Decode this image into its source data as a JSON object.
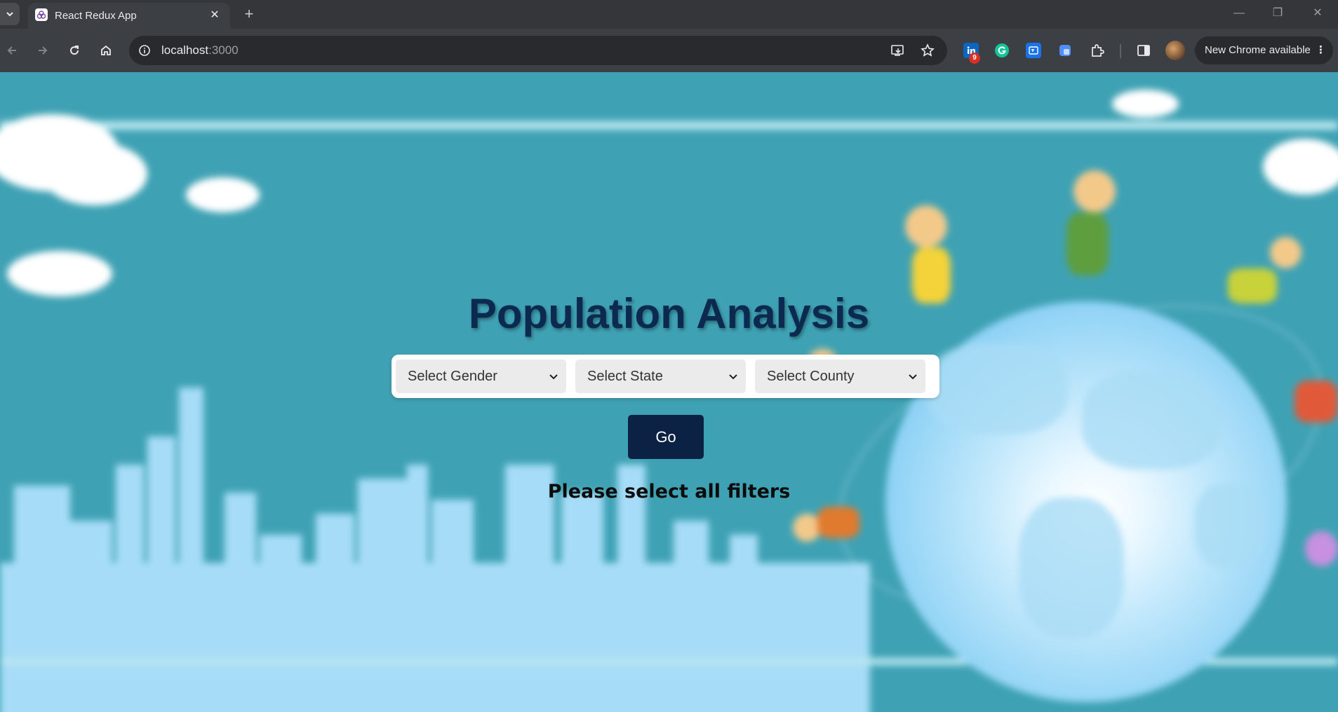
{
  "browser": {
    "tab_title": "React Redux App",
    "new_tab_label": "+",
    "close_label": "✕",
    "url_host": "localhost",
    "url_port": ":3000",
    "extension_badge": "9",
    "update_chip_label": "New Chrome available",
    "minimize_label": "—",
    "restore_label": "❐",
    "window_close_label": "✕"
  },
  "page": {
    "title": "Population Analysis",
    "filters": {
      "gender_placeholder": "Select Gender",
      "state_placeholder": "Select State",
      "county_placeholder": "Select County"
    },
    "go_label": "Go",
    "message": "Please select all filters"
  },
  "colors": {
    "page_background": "#3fa2b4",
    "title": "#0c2a4f",
    "go_button": "#0b2244",
    "chrome_bar": "#3c3f43"
  },
  "icons": {
    "tab_search": "chevron-down-icon",
    "favicon": "react-redux-favicon",
    "back": "back-arrow-icon",
    "forward": "forward-arrow-icon",
    "reload": "reload-icon",
    "home": "home-icon",
    "site_info": "site-info-icon",
    "install": "install-app-icon",
    "bookmark": "star-icon",
    "extensions": "puzzle-icon",
    "side_panel": "side-panel-icon"
  }
}
